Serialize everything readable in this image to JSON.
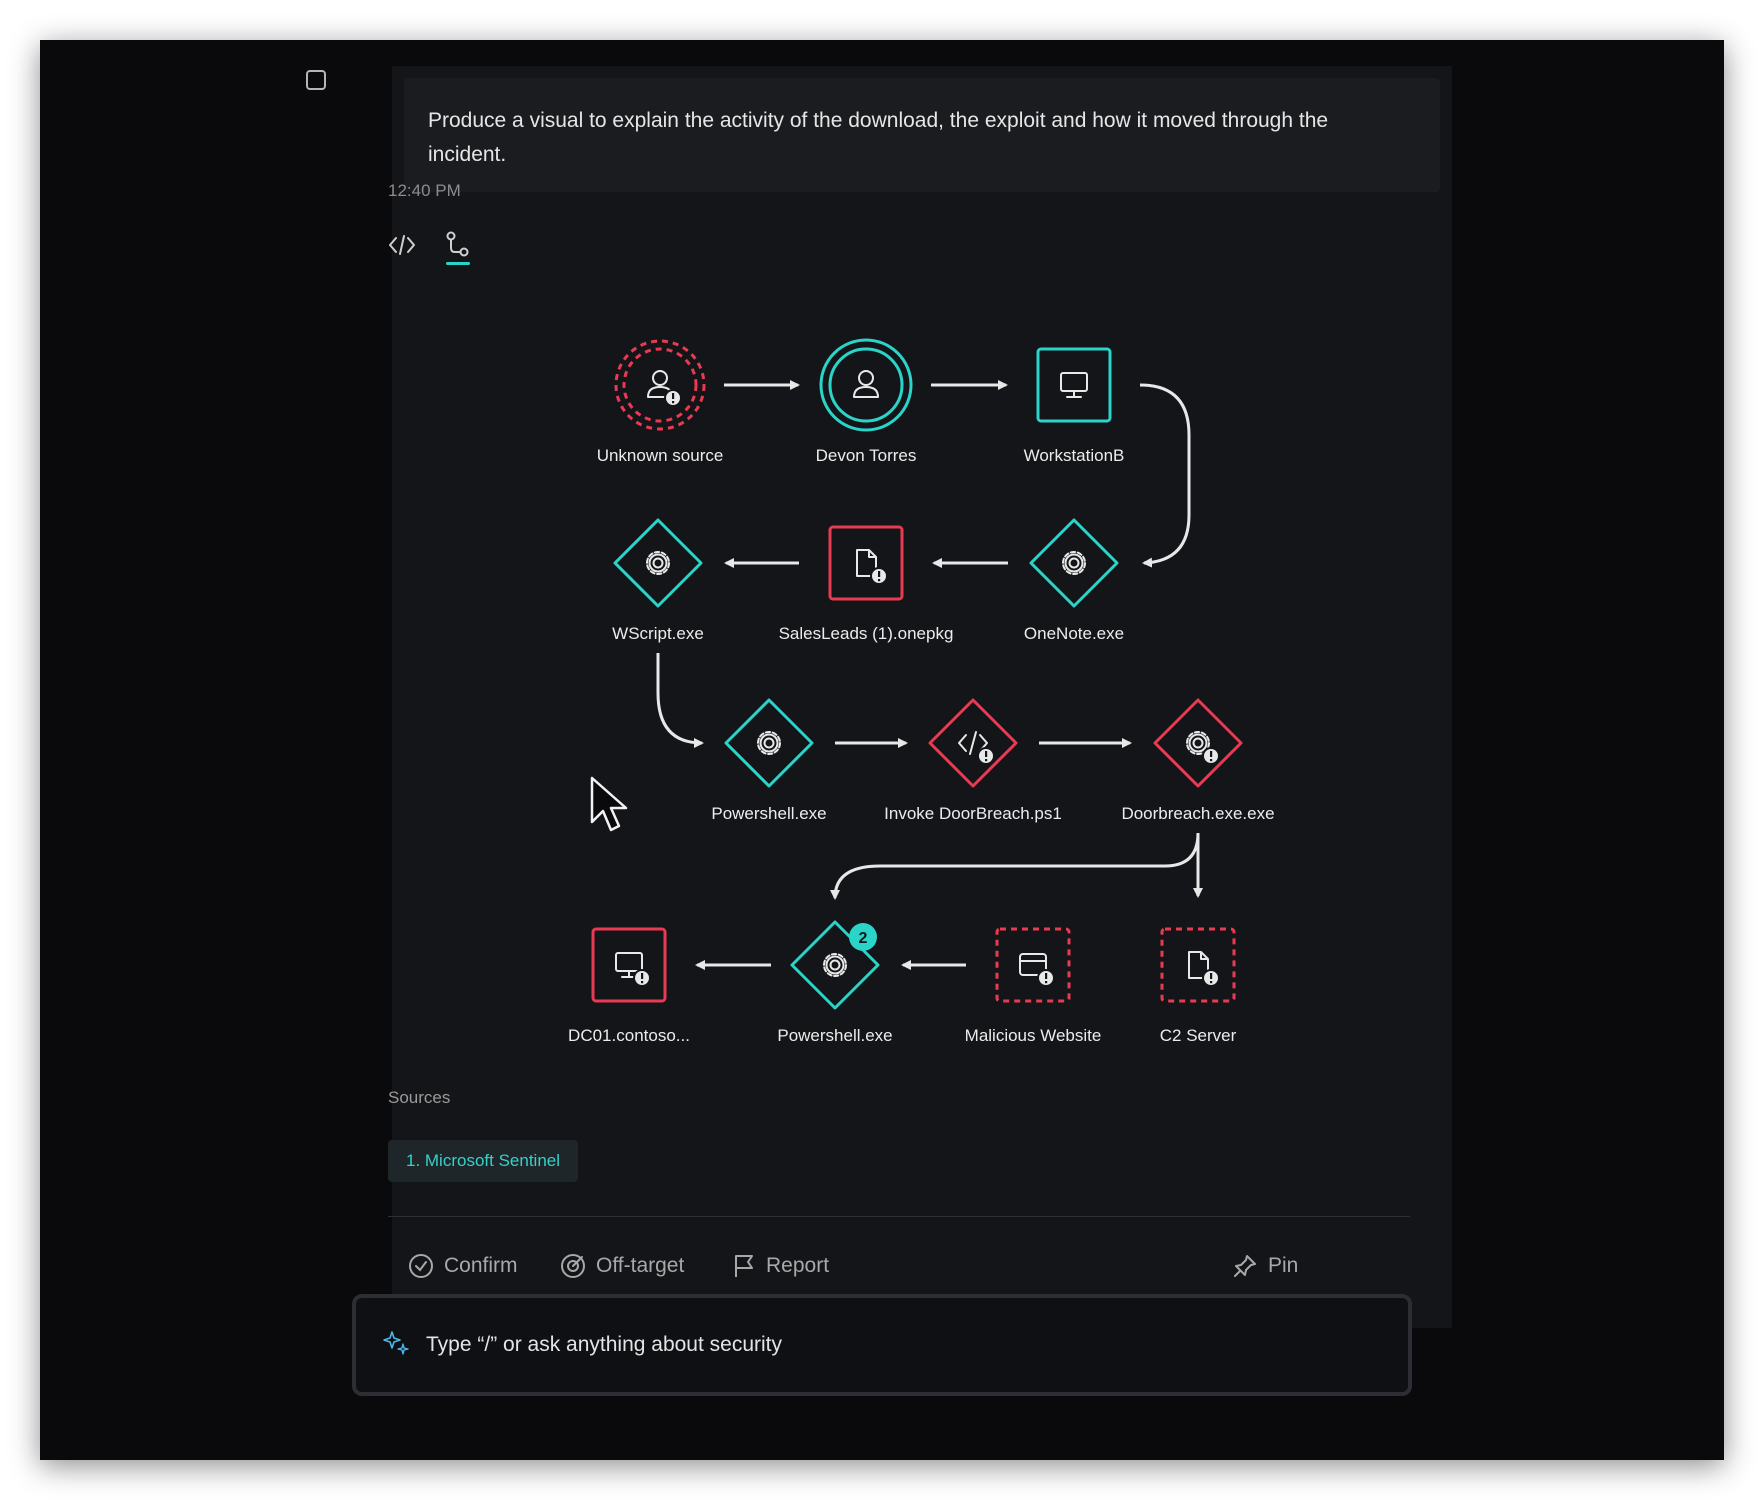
{
  "prompt": {
    "text": "Produce a visual to explain the activity of the download, the exploit and how it moved through the incident."
  },
  "response": {
    "timestamp": "12:40 PM",
    "view_tabs": [
      {
        "name": "code-view",
        "icon": "code-icon",
        "selected": false
      },
      {
        "name": "graph-view",
        "icon": "graph-icon",
        "selected": true
      }
    ],
    "colors": {
      "safe": "#2bd4c8",
      "malicious": "#e83a52",
      "badge": "#2bd4c8"
    }
  },
  "graph": {
    "nodes": [
      {
        "id": "unknown_source",
        "label": "Unknown source",
        "shape": "circle",
        "style": "malicious-dashed",
        "icon": "user-icon",
        "alert": true
      },
      {
        "id": "devon_torres",
        "label": "Devon Torres",
        "shape": "circle",
        "style": "safe",
        "icon": "user-icon",
        "alert": false
      },
      {
        "id": "workstation_b",
        "label": "WorkstationB",
        "shape": "square",
        "style": "safe",
        "icon": "monitor-icon",
        "alert": false
      },
      {
        "id": "onenote",
        "label": "OneNote.exe",
        "shape": "diamond",
        "style": "safe",
        "icon": "gear-icon",
        "alert": false
      },
      {
        "id": "salesleads",
        "label": "SalesLeads (1).onepkg",
        "shape": "square",
        "style": "malicious",
        "icon": "file-icon",
        "alert": true
      },
      {
        "id": "wscript",
        "label": "WScript.exe",
        "shape": "diamond",
        "style": "safe",
        "icon": "gear-icon",
        "alert": false
      },
      {
        "id": "powershell_1",
        "label": "Powershell.exe",
        "shape": "diamond",
        "style": "safe",
        "icon": "gear-icon",
        "alert": false
      },
      {
        "id": "invoke_doorbreach",
        "label": "Invoke DoorBreach.ps1",
        "shape": "diamond",
        "style": "malicious",
        "icon": "code-icon",
        "alert": true
      },
      {
        "id": "doorbreach_exe",
        "label": "Doorbreach.exe.exe",
        "shape": "diamond",
        "style": "malicious",
        "icon": "gear-icon",
        "alert": true
      },
      {
        "id": "c2_server",
        "label": "C2 Server",
        "shape": "square",
        "style": "malicious-dashed",
        "icon": "file-icon",
        "alert": true
      },
      {
        "id": "malicious_website",
        "label": "Malicious Website",
        "shape": "square",
        "style": "malicious-dashed",
        "icon": "window-icon",
        "alert": true
      },
      {
        "id": "powershell_2",
        "label": "Powershell.exe",
        "shape": "diamond",
        "style": "safe",
        "icon": "gear-icon",
        "alert": false,
        "badge": "2"
      },
      {
        "id": "dc01",
        "label": "DC01.contoso...",
        "shape": "square",
        "style": "malicious",
        "icon": "monitor-icon",
        "alert": true
      }
    ],
    "edges": [
      [
        "unknown_source",
        "devon_torres"
      ],
      [
        "devon_torres",
        "workstation_b"
      ],
      [
        "workstation_b",
        "onenote"
      ],
      [
        "onenote",
        "salesleads"
      ],
      [
        "salesleads",
        "wscript"
      ],
      [
        "wscript",
        "powershell_1"
      ],
      [
        "powershell_1",
        "invoke_doorbreach"
      ],
      [
        "invoke_doorbreach",
        "doorbreach_exe"
      ],
      [
        "doorbreach_exe",
        "c2_server"
      ],
      [
        "doorbreach_exe",
        "powershell_2"
      ],
      [
        "malicious_website",
        "powershell_2"
      ],
      [
        "powershell_2",
        "dc01"
      ]
    ]
  },
  "sources": {
    "label": "Sources",
    "items": [
      {
        "label": "1. Microsoft Sentinel"
      }
    ]
  },
  "actions": {
    "confirm": "Confirm",
    "off_target": "Off-target",
    "report": "Report",
    "pin": "Pin"
  },
  "input": {
    "placeholder": "Type “/” or ask anything about security",
    "icon": "sparkle-icon"
  }
}
